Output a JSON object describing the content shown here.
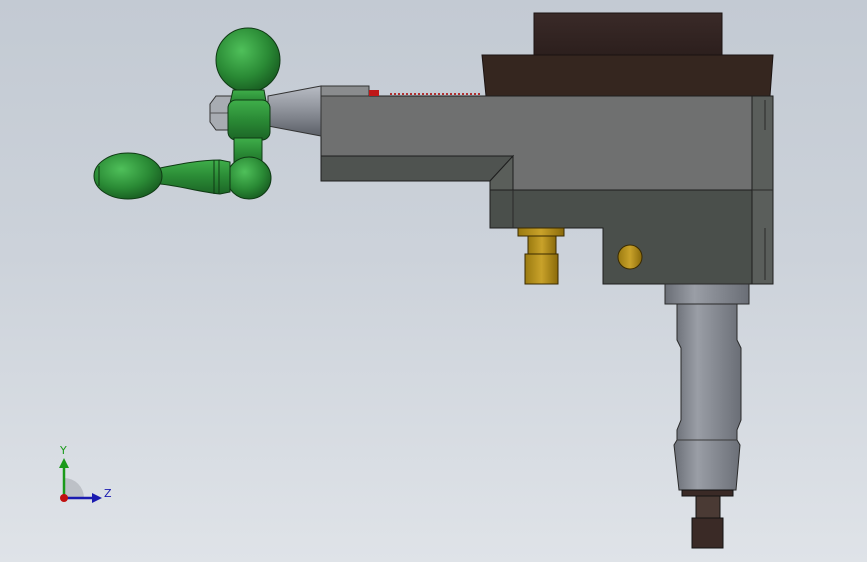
{
  "viewport": {
    "background_top": "#c3cad3",
    "background_bottom": "#dfe3e8"
  },
  "model": {
    "parts": [
      "green-handwheel",
      "hex-nut",
      "tapered-shaft",
      "main-housing",
      "dark-top-cap",
      "brass-fitting",
      "brass-plug",
      "spindle",
      "tool-holder"
    ],
    "colors": {
      "housing": "#6e6e6e",
      "housing_lower": "#4a4e4a",
      "cap": "#3a2a26",
      "handwheel": "#2e8a3a",
      "brass": "#b8901a",
      "spindle": "#8a8a8a"
    }
  },
  "triad": {
    "y_label": "Y",
    "z_label": "Z",
    "colors": {
      "y": "#1a9a1a",
      "z": "#1a1ab0",
      "origin": "#c01010"
    }
  }
}
